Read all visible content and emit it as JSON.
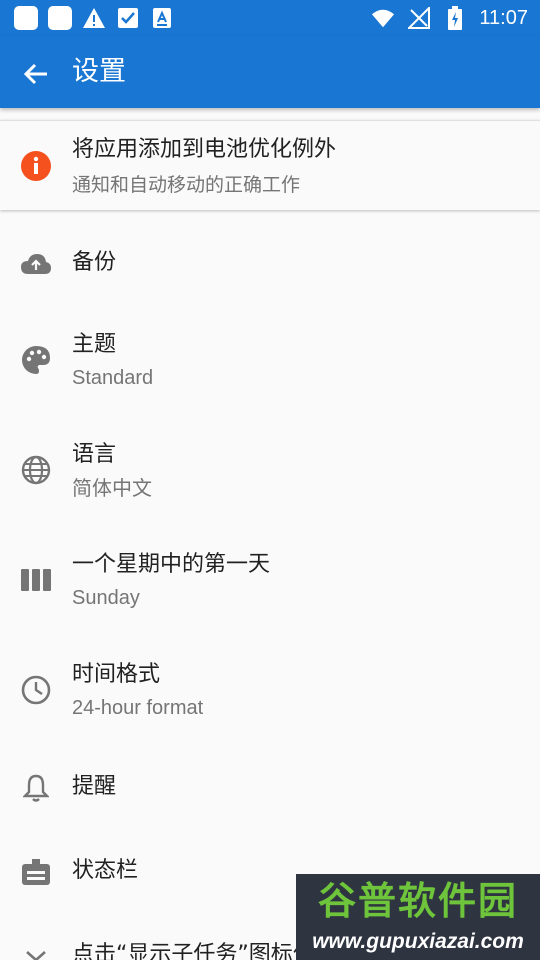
{
  "status_bar": {
    "time": "11:07",
    "left_icons": [
      "app-icon",
      "app-icon",
      "warning-icon",
      "checkbox-icon",
      "font-icon"
    ],
    "right_icons": [
      "wifi-icon",
      "no-signal-icon",
      "battery-charging-icon"
    ]
  },
  "app_bar": {
    "title": "设置",
    "back_icon": "arrow-back-icon",
    "color": "#1976d2"
  },
  "battery_card": {
    "title": "将应用添加到电池优化例外",
    "subtitle": "通知和自动移动的正确工作",
    "icon": "info-icon",
    "icon_color": "#f4511e"
  },
  "settings": [
    {
      "key": "backup",
      "icon": "cloud-upload-icon",
      "title": "备份",
      "subtitle": ""
    },
    {
      "key": "theme",
      "icon": "palette-icon",
      "title": "主题",
      "subtitle": "Standard"
    },
    {
      "key": "language",
      "icon": "globe-icon",
      "title": "语言",
      "subtitle": "简体中文"
    },
    {
      "key": "first_day",
      "icon": "week-icon",
      "title": "一个星期中的第一天",
      "subtitle": "Sunday"
    },
    {
      "key": "time_format",
      "icon": "clock-icon",
      "title": "时间格式",
      "subtitle": "24-hour format"
    },
    {
      "key": "reminder",
      "icon": "bell-icon",
      "title": "提醒",
      "subtitle": ""
    },
    {
      "key": "status_bar",
      "icon": "briefcase-icon",
      "title": "状态栏",
      "subtitle": ""
    },
    {
      "key": "subtasks",
      "icon": "chevron-down-icon",
      "title": "点击“显示子任务”图标位置",
      "subtitle": ""
    }
  ],
  "watermark": {
    "brand": "谷普软件园",
    "url": "www.gupuxiazai.com"
  }
}
